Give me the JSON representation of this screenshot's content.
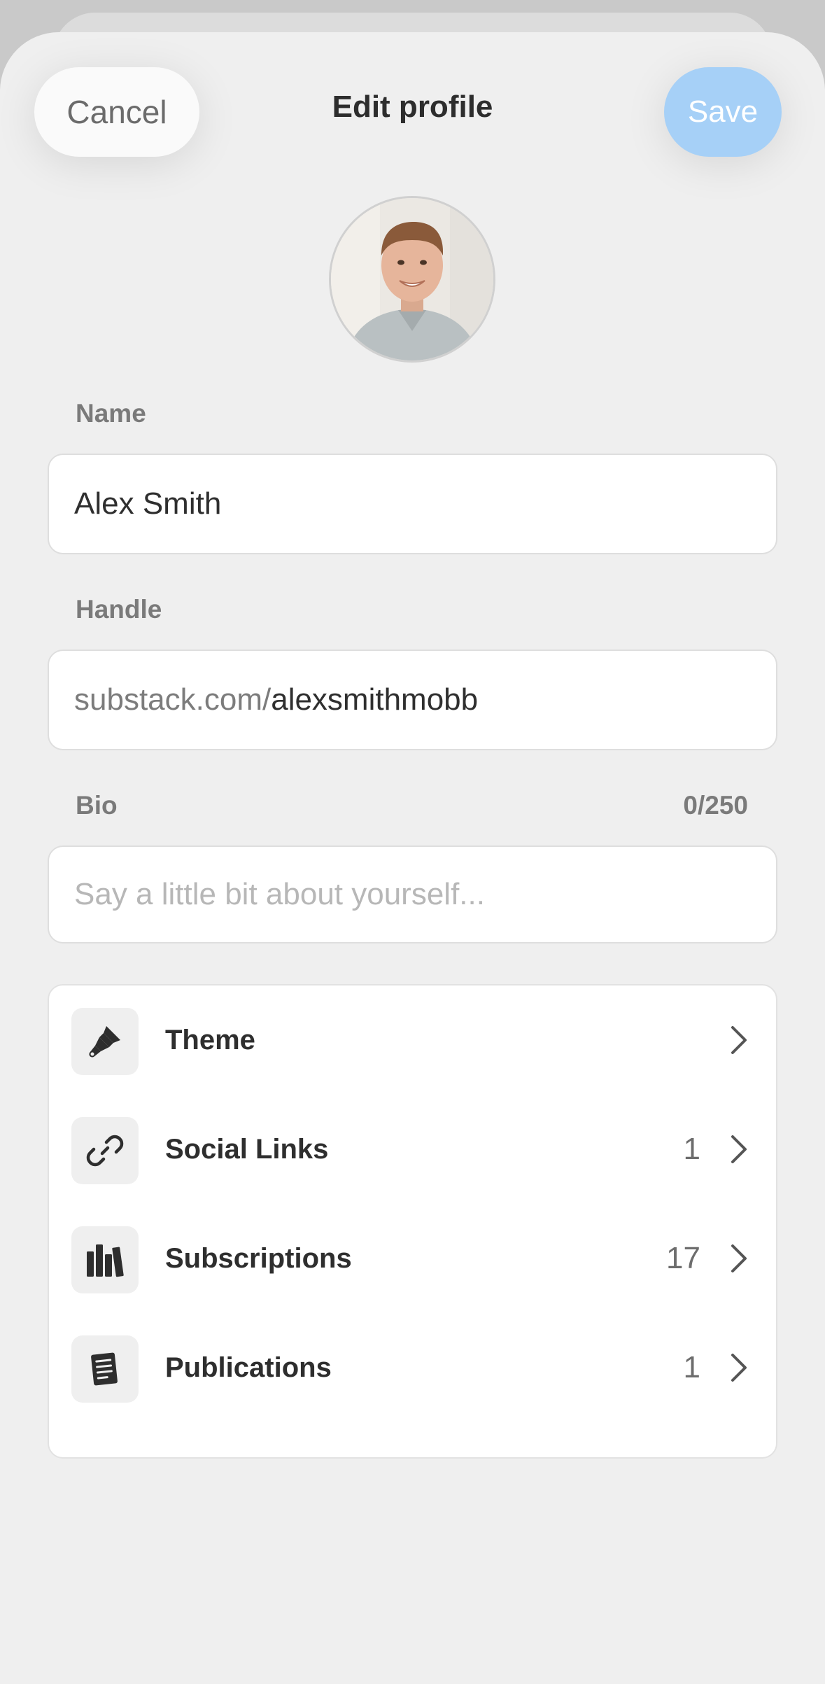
{
  "header": {
    "cancel_label": "Cancel",
    "title": "Edit profile",
    "save_label": "Save"
  },
  "form": {
    "name": {
      "label": "Name",
      "value": "Alex Smith"
    },
    "handle": {
      "label": "Handle",
      "prefix": "substack.com/",
      "value": "alexsmithmobb"
    },
    "bio": {
      "label": "Bio",
      "counter": "0/250",
      "placeholder": "Say a little bit about yourself..."
    }
  },
  "menu": {
    "items": [
      {
        "label": "Theme",
        "count": "",
        "icon": "paintbrush-icon"
      },
      {
        "label": "Social Links",
        "count": "1",
        "icon": "link-icon"
      },
      {
        "label": "Subscriptions",
        "count": "17",
        "icon": "books-icon"
      },
      {
        "label": "Publications",
        "count": "1",
        "icon": "document-icon"
      }
    ]
  },
  "colors": {
    "accent_save": "#a6d0f7",
    "sheet_bg": "#efefef",
    "text_primary": "#2e2e2e",
    "text_secondary": "#7a7a7a"
  }
}
